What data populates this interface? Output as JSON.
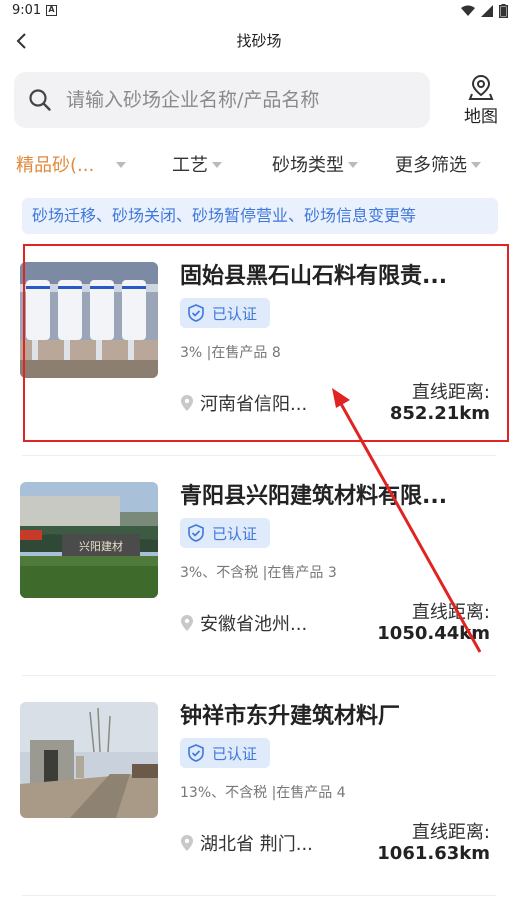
{
  "status_bar": {
    "time": "9:01",
    "a_label": "A"
  },
  "header": {
    "title": "找砂场"
  },
  "search": {
    "placeholder": "请输入砂场企业名称/产品名称",
    "map_label": "地图"
  },
  "filters": [
    {
      "label": "精品砂(...",
      "active": true
    },
    {
      "label": "工艺",
      "active": false
    },
    {
      "label": "砂场类型",
      "active": false
    },
    {
      "label": "更多筛选",
      "active": false
    }
  ],
  "notice": "砂场迁移、砂场关闭、砂场暂停营业、砂场信息变更等",
  "items": [
    {
      "title": "固始县黑石山石料有限责...",
      "badge": "已认证",
      "meta": "3% |在售产品 8",
      "location": "河南省信阳...",
      "distance_label": "直线距离:",
      "distance": "852.21km"
    },
    {
      "title": "青阳县兴阳建筑材料有限...",
      "badge": "已认证",
      "meta": "3%、不含税 |在售产品 3",
      "location": "安徽省池州...",
      "distance_label": "直线距离:",
      "distance": "1050.44km",
      "sign_text": "兴阳建材"
    },
    {
      "title": "钟祥市东升建筑材料厂",
      "badge": "已认证",
      "meta": "13%、不含税 |在售产品 4",
      "location": "湖北省 荆门...",
      "distance_label": "直线距离:",
      "distance": "1061.63km"
    }
  ],
  "colors": {
    "accent_orange": "#e08a3c",
    "badge_blue": "#3f78d9",
    "highlight_red": "#e02424"
  }
}
